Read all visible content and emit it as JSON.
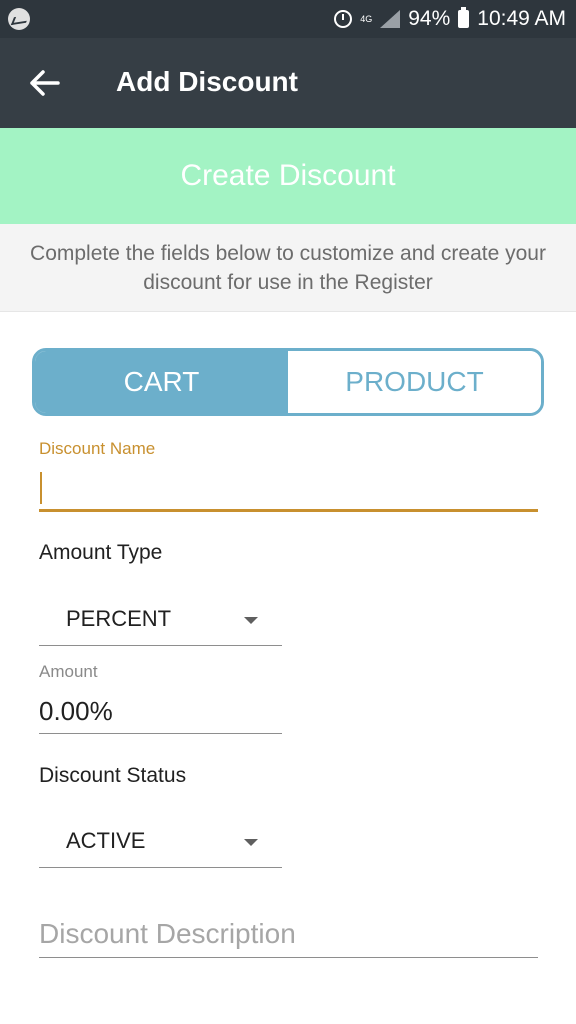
{
  "status_bar": {
    "battery": "94%",
    "time": "10:49 AM",
    "network": "4G",
    "icons": [
      "messenger-icon",
      "alarm-icon",
      "network-4g-icon",
      "signal-icon",
      "battery-icon"
    ]
  },
  "app_bar": {
    "title": "Add Discount",
    "back_icon": "arrow-back-icon"
  },
  "banner": {
    "title": "Create Discount"
  },
  "instructions": {
    "text": "Complete the fields below to customize and create your discount for use in the Register"
  },
  "segment": {
    "options": [
      "CART",
      "PRODUCT"
    ],
    "selected": "CART"
  },
  "form": {
    "discount_name_label": "Discount Name",
    "discount_name_value": "",
    "amount_type_label": "Amount Type",
    "amount_type_value": "PERCENT",
    "amount_label": "Amount",
    "amount_value": "0.00%",
    "discount_status_label": "Discount Status",
    "discount_status_value": "ACTIVE",
    "description_placeholder": "Discount Description"
  },
  "colors": {
    "app_bar": "#363e45",
    "status_bar": "#2e363d",
    "banner": "#a3f3c4",
    "accent_blue": "#6cafcb",
    "accent_gold": "#c8902f"
  }
}
